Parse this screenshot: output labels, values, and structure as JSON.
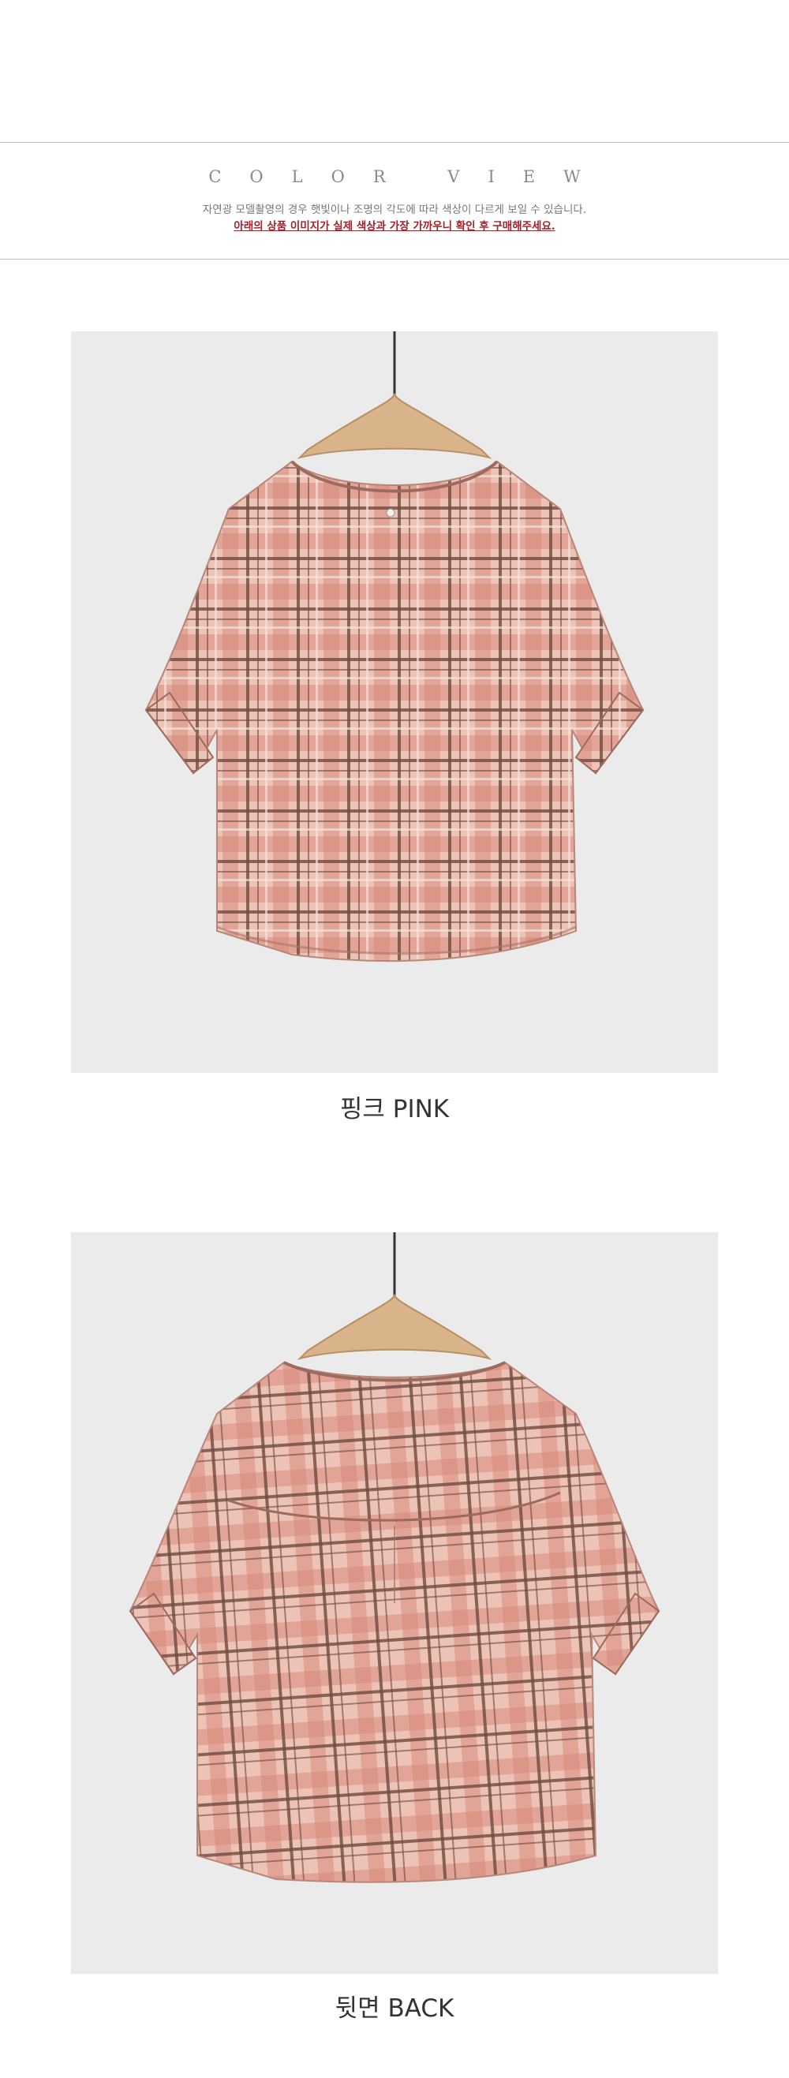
{
  "header": {
    "title": "COLOR VIEW",
    "note": "자연광 모델촬영의 경우 햇빛이나 조명의 각도에 따라 색상이 다르게 보일 수 있습니다.",
    "notice": "아래의 상품 이미지가 실제 색상과 가장 가까우니 확인 후 구매해주세요."
  },
  "products": [
    {
      "caption": "핑크 PINK",
      "view": "front",
      "icon": "pink-check-blouse-front"
    },
    {
      "caption": "뒷면 BACK",
      "view": "back",
      "icon": "pink-check-blouse-back"
    }
  ],
  "colors": {
    "plaid_base": "#e8b4a6",
    "plaid_pink": "#d98a7c",
    "plaid_brown": "#6e4a40",
    "background": "#ebebeb"
  }
}
